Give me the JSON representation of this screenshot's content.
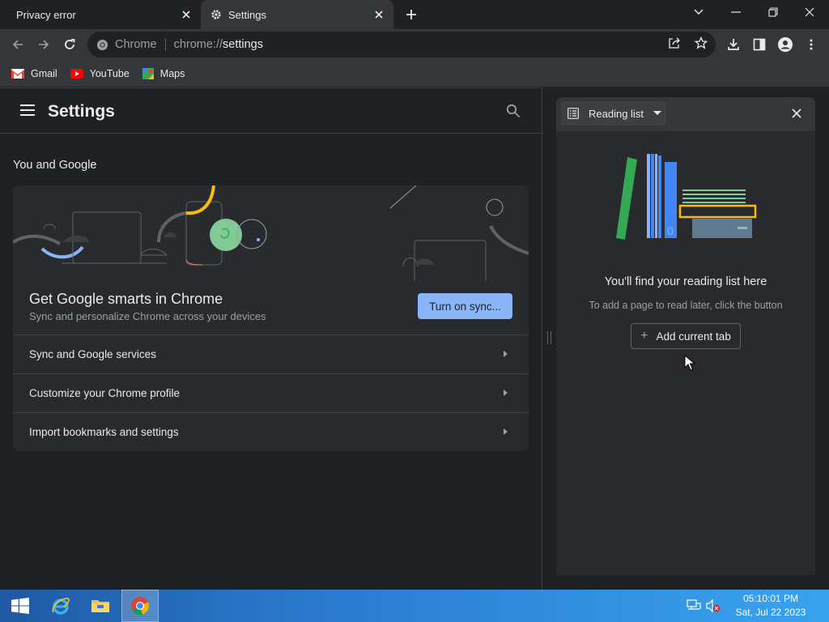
{
  "tabs": [
    {
      "title": "Privacy error",
      "active": false
    },
    {
      "title": "Settings",
      "active": true
    }
  ],
  "omnibox": {
    "chip": "Chrome",
    "url_scheme": "chrome://",
    "url_host": "settings"
  },
  "bookmarks": [
    {
      "label": "Gmail",
      "icon": "gmail-icon"
    },
    {
      "label": "YouTube",
      "icon": "youtube-icon"
    },
    {
      "label": "Maps",
      "icon": "maps-icon"
    }
  ],
  "settings": {
    "title": "Settings",
    "section": "You and Google",
    "promo_title": "Get Google smarts in Chrome",
    "promo_subtitle": "Sync and personalize Chrome across your devices",
    "sync_button": "Turn on sync...",
    "rows": [
      "Sync and Google services",
      "Customize your Chrome profile",
      "Import bookmarks and settings"
    ]
  },
  "side_panel": {
    "selector_label": "Reading list",
    "empty_title": "You'll find your reading list here",
    "empty_subtitle": "To add a page to read later, click the button",
    "add_button": "Add current tab"
  },
  "taskbar": {
    "time": "05:10:01 PM",
    "date": "Sat, Jul 22 2023"
  },
  "colors": {
    "accent_blue": "#8ab4f8",
    "frame": "#202124",
    "toolbar": "#35363a",
    "surface": "#292a2d"
  }
}
